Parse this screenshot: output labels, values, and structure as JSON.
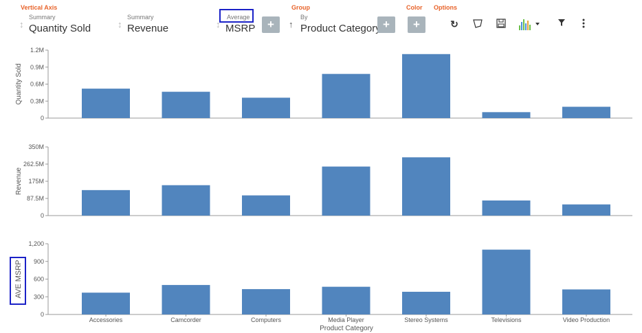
{
  "toolbar": {
    "vertical_axis_label": "Vertical Axis",
    "group_label": "Group",
    "color_label": "Color",
    "options_label": "Options",
    "fields": [
      {
        "small": "Summary",
        "big": "Quantity Sold"
      },
      {
        "small": "Summary",
        "big": "Revenue"
      },
      {
        "small": "Average",
        "big": "MSRP"
      }
    ],
    "group_field": {
      "small": "By",
      "big": "Product Category"
    },
    "plus": "+",
    "icons": [
      "refresh-icon",
      "annotate-icon",
      "save-icon",
      "chart-type-icon",
      "filter-icon",
      "more-icon"
    ],
    "colors": {
      "accent_label": "#e8632a",
      "highlight_box": "#1a21c7",
      "button_gray": "#a9b4bb",
      "bar": "#5185be"
    }
  },
  "chart_data": [
    {
      "type": "bar",
      "ylabel": "Quantity Sold",
      "ylim": [
        0,
        1200000
      ],
      "yticks": [
        "0",
        "0.3M",
        "0.6M",
        "0.9M",
        "1.2M"
      ],
      "categories": [
        "Accessories",
        "Camcorder",
        "Computers",
        "Media Player",
        "Stereo Systems",
        "Televisions",
        "Video Production"
      ],
      "values": [
        520000,
        465000,
        360000,
        780000,
        1130000,
        105000,
        200000
      ]
    },
    {
      "type": "bar",
      "ylabel": "Revenue",
      "ylim": [
        0,
        350000000
      ],
      "yticks": [
        "0",
        "87.5M",
        "175M",
        "262.5M",
        "350M"
      ],
      "categories": [
        "Accessories",
        "Camcorder",
        "Computers",
        "Media Player",
        "Stereo Systems",
        "Televisions",
        "Video Production"
      ],
      "values": [
        130000000,
        155000000,
        103000000,
        250000000,
        297000000,
        77000000,
        57000000
      ]
    },
    {
      "type": "bar",
      "ylabel": "AVE MSRP",
      "xlabel": "Product Category",
      "ylim": [
        0,
        1200
      ],
      "yticks": [
        "0",
        "300",
        "600",
        "900",
        "1,200"
      ],
      "categories": [
        "Accessories",
        "Camcorder",
        "Computers",
        "Media Player",
        "Stereo Systems",
        "Televisions",
        "Video Production"
      ],
      "values": [
        370,
        500,
        430,
        470,
        385,
        1100,
        425
      ]
    }
  ]
}
